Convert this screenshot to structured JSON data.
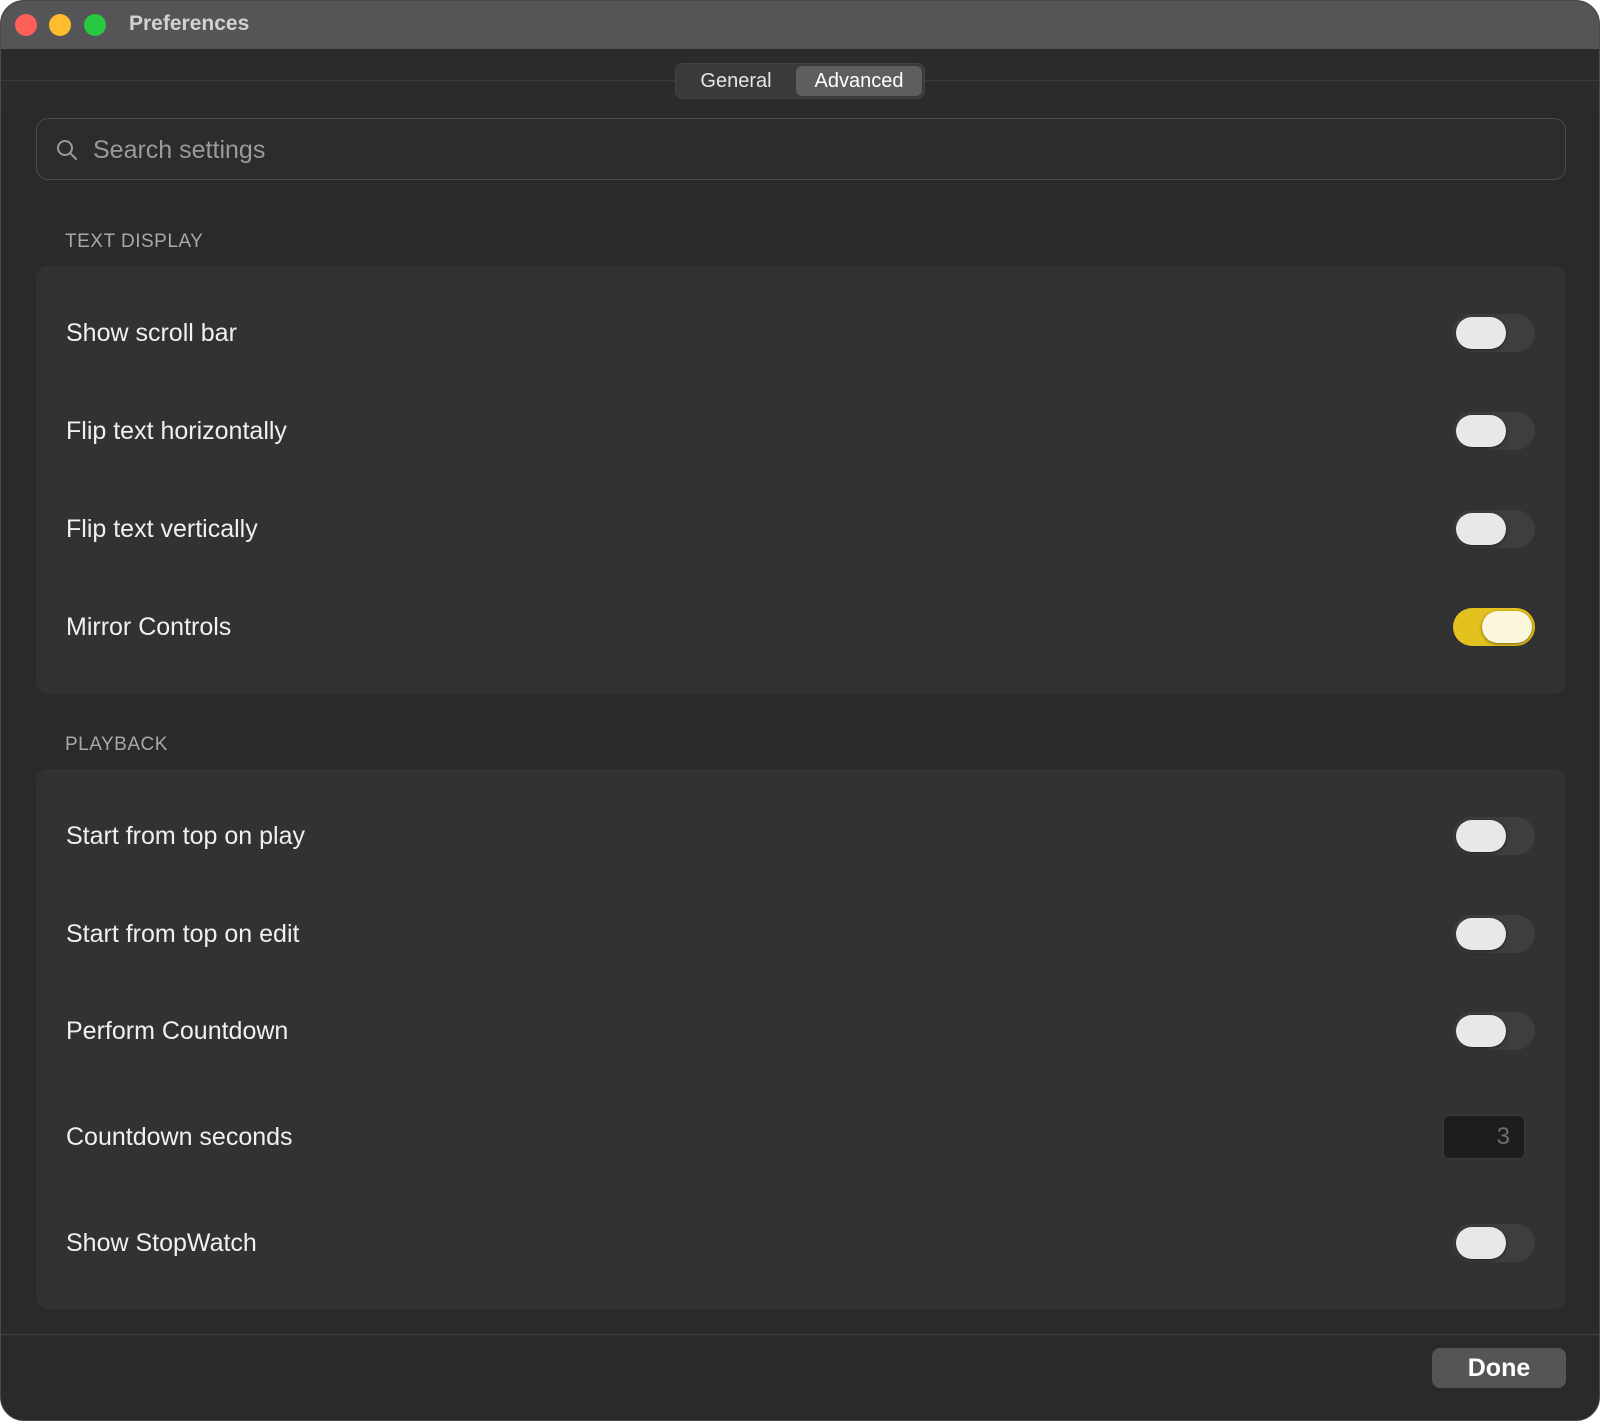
{
  "window": {
    "title": "Preferences"
  },
  "tabs": [
    {
      "label": "General",
      "selected": false
    },
    {
      "label": "Advanced",
      "selected": true
    }
  ],
  "search": {
    "placeholder": "Search settings",
    "value": ""
  },
  "sections": {
    "text_display": {
      "title": "TEXT DISPLAY",
      "rows": [
        {
          "label": "Show scroll bar",
          "on": false
        },
        {
          "label": "Flip text horizontally",
          "on": false
        },
        {
          "label": "Flip text vertically",
          "on": false
        },
        {
          "label": "Mirror Controls",
          "on": true
        }
      ]
    },
    "playback": {
      "title": "PLAYBACK",
      "rows": [
        {
          "label": "Start from top on play",
          "on": false
        },
        {
          "label": "Start from top on edit",
          "on": false
        },
        {
          "label": "Perform Countdown",
          "on": false
        },
        {
          "label": "Countdown seconds",
          "value": "3"
        },
        {
          "label": "Show StopWatch",
          "on": false
        }
      ]
    }
  },
  "footer": {
    "done_label": "Done"
  },
  "colors": {
    "accent_toggle_on": "#e3c11f",
    "window_bg": "#2a2a2a",
    "panel_bg": "#323232"
  }
}
